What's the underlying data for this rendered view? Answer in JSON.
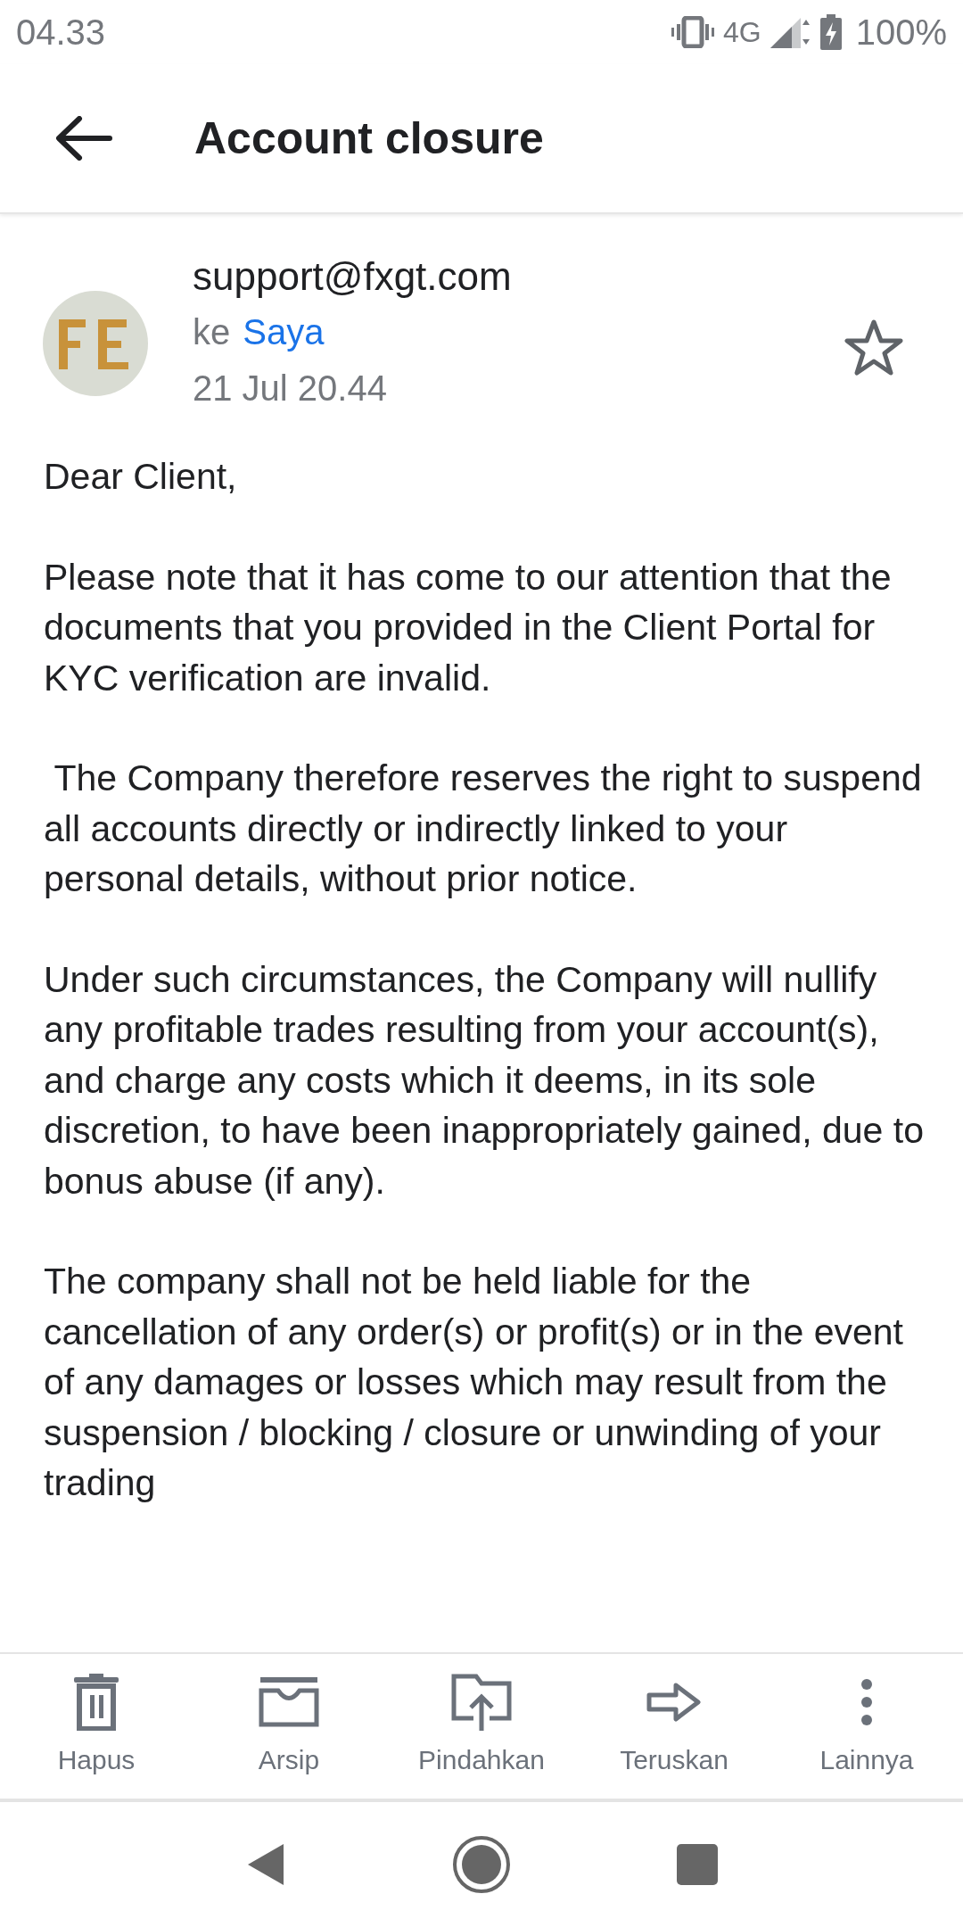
{
  "status_bar": {
    "time": "04.33",
    "network": "4G",
    "battery": "100%"
  },
  "header": {
    "title": "Account closure"
  },
  "message": {
    "sender": "support@fxgt.com",
    "to_prefix": "ke",
    "to": "Saya",
    "date": "21 Jul 20.44",
    "starred": false,
    "paragraphs": [
      "Dear Client,",
      "Please note that it has come to our attention that the documents that you provided in the Client Portal for KYC verification are invalid.",
      " The Company therefore reserves the right to suspend all accounts directly or indirectly linked to your personal details, without prior notice.",
      "Under such circumstances, the Company will nullify any profitable trades resulting from your account(s), and charge any costs which it deems, in its sole discretion, to have been inappropriately gained, due to bonus abuse (if any).",
      "The company shall not be held liable for the cancellation of any order(s) or profit(s) or in the event of any damages or losses which may result from the suspension / blocking / closure or unwinding of your trading"
    ]
  },
  "toolbar": [
    {
      "kind": "delete",
      "label": "Hapus"
    },
    {
      "kind": "archive",
      "label": "Arsip"
    },
    {
      "kind": "move",
      "label": "Pindahkan"
    },
    {
      "kind": "forward",
      "label": "Teruskan"
    },
    {
      "kind": "more",
      "label": "Lainnya"
    }
  ]
}
